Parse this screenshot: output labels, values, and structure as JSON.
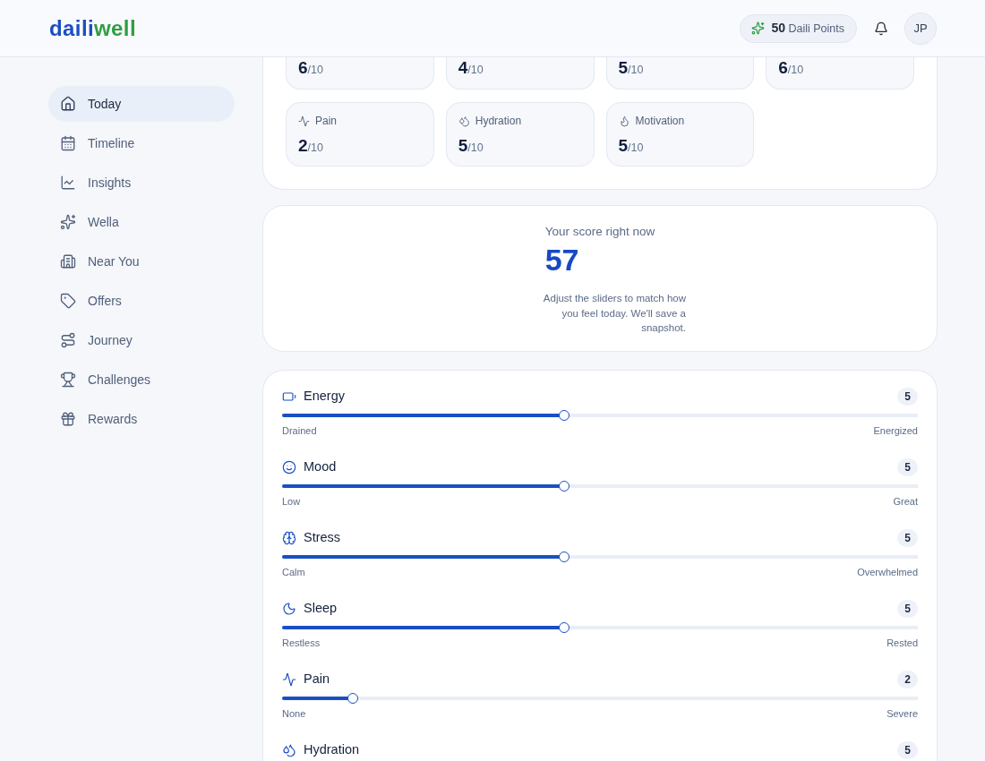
{
  "header": {
    "logo": [
      {
        "text": "daili",
        "color": "#1a4fc4"
      },
      {
        "text": "well",
        "color": "#2f9e44"
      }
    ],
    "points": "**50** Daili Points",
    "avatar": "JP"
  },
  "sidebar": {
    "items": [
      {
        "label": "Today",
        "selected": true
      },
      {
        "label": "Timeline",
        "selected": false
      },
      {
        "label": "Insights",
        "selected": false
      },
      {
        "label": "Wella",
        "selected": false
      },
      {
        "label": "Near You",
        "selected": false
      },
      {
        "label": "Offers",
        "selected": false
      },
      {
        "label": "Journey",
        "selected": false
      },
      {
        "label": "Challenges",
        "selected": false
      },
      {
        "label": "Rewards",
        "selected": false
      }
    ]
  },
  "checkin_cards": [
    {
      "rating": "**6**/10"
    },
    {
      "rating": "**4**/10"
    },
    {
      "rating": "**5**/10"
    },
    {
      "rating": "**6**/10"
    },
    {
      "label": "Pain",
      "rating": "**2**/10"
    },
    {
      "label": "Hydration",
      "rating": "**5**/10"
    },
    {
      "label": "Motivation",
      "rating": "**5**/10"
    }
  ],
  "score": {
    "title": "Your score right now",
    "value": "57",
    "hint": "Adjust the sliders to match how you feel today. We'll save a snapshot."
  },
  "sliders": [
    {
      "label": "Energy",
      "value": "5",
      "level": 0.444,
      "min_label": "Drained",
      "max_label": "Energized"
    },
    {
      "label": "Mood",
      "value": "5",
      "level": 0.444,
      "min_label": "Low",
      "max_label": "Great"
    },
    {
      "label": "Stress",
      "value": "5",
      "level": 0.444,
      "min_label": "Calm",
      "max_label": "Overwhelmed"
    },
    {
      "label": "Sleep",
      "value": "5",
      "level": 0.444,
      "min_label": "Restless",
      "max_label": "Rested"
    },
    {
      "label": "Pain",
      "value": "2",
      "level": 0.111,
      "min_label": "None",
      "max_label": "Severe"
    },
    {
      "label": "Hydration",
      "value": "5"
    }
  ]
}
